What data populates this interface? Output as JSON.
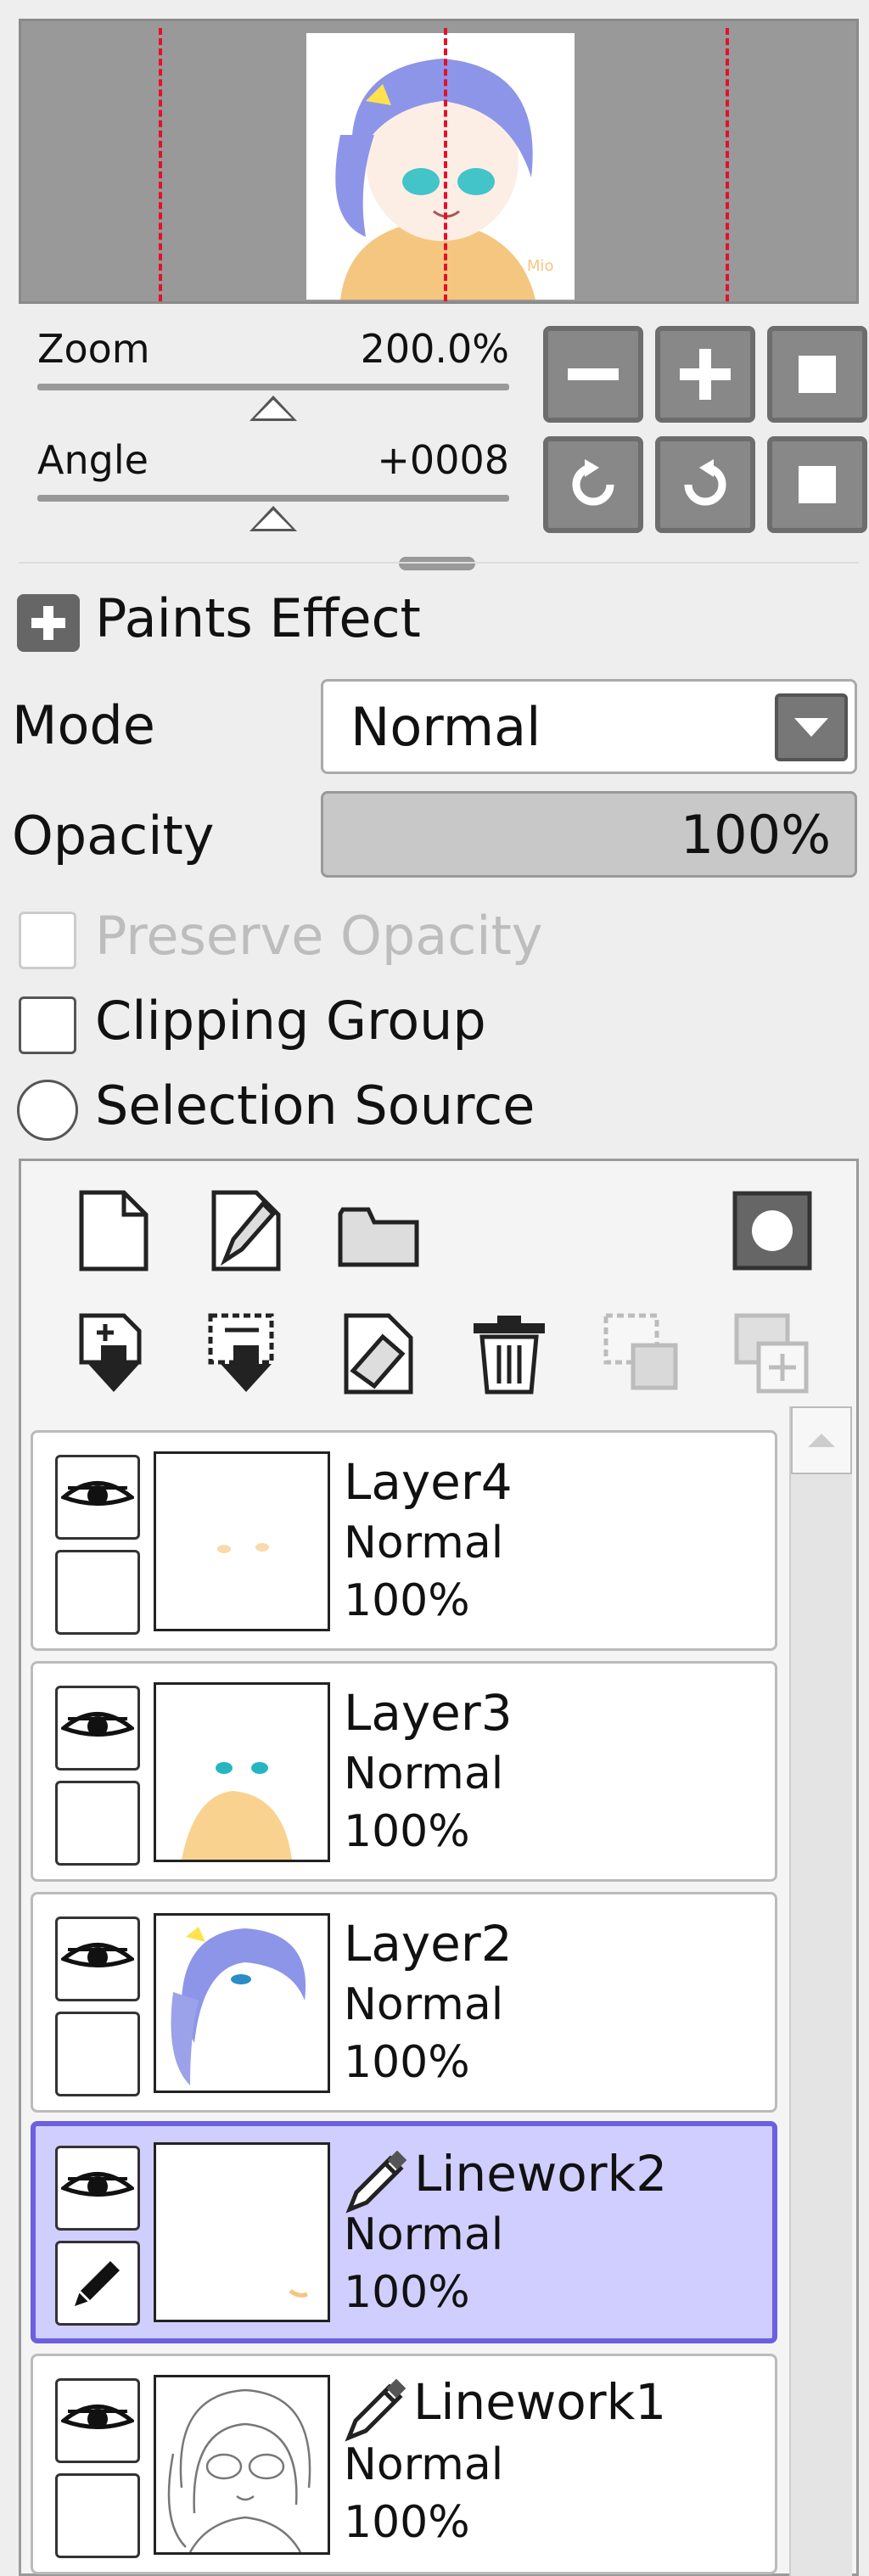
{
  "navigator": {
    "zoom_label": "Zoom",
    "zoom_value": "200.0%",
    "zoom_level": 0.5,
    "angle_label": "Angle",
    "angle_value": "+0008",
    "angle_level": 0.5
  },
  "paints_effect_label": "Paints Effect",
  "mode": {
    "label": "Mode",
    "value": "Normal"
  },
  "opacity": {
    "label": "Opacity",
    "value": "100%"
  },
  "checks": {
    "preserve_opacity": "Preserve Opacity",
    "clipping_group": "Clipping Group",
    "selection_source": "Selection Source"
  },
  "layers": [
    {
      "name": "Layer4",
      "mode": "Normal",
      "opacity": "100%"
    },
    {
      "name": "Layer3",
      "mode": "Normal",
      "opacity": "100%"
    },
    {
      "name": "Layer2",
      "mode": "Normal",
      "opacity": "100%"
    },
    {
      "name": "Linework2",
      "mode": "Normal",
      "opacity": "100%"
    },
    {
      "name": "Linework1",
      "mode": "Normal",
      "opacity": "100%"
    }
  ],
  "colors": {
    "selection": "#d0ceff",
    "selection_border": "#6d5fe0",
    "guide": "#e4102a"
  }
}
